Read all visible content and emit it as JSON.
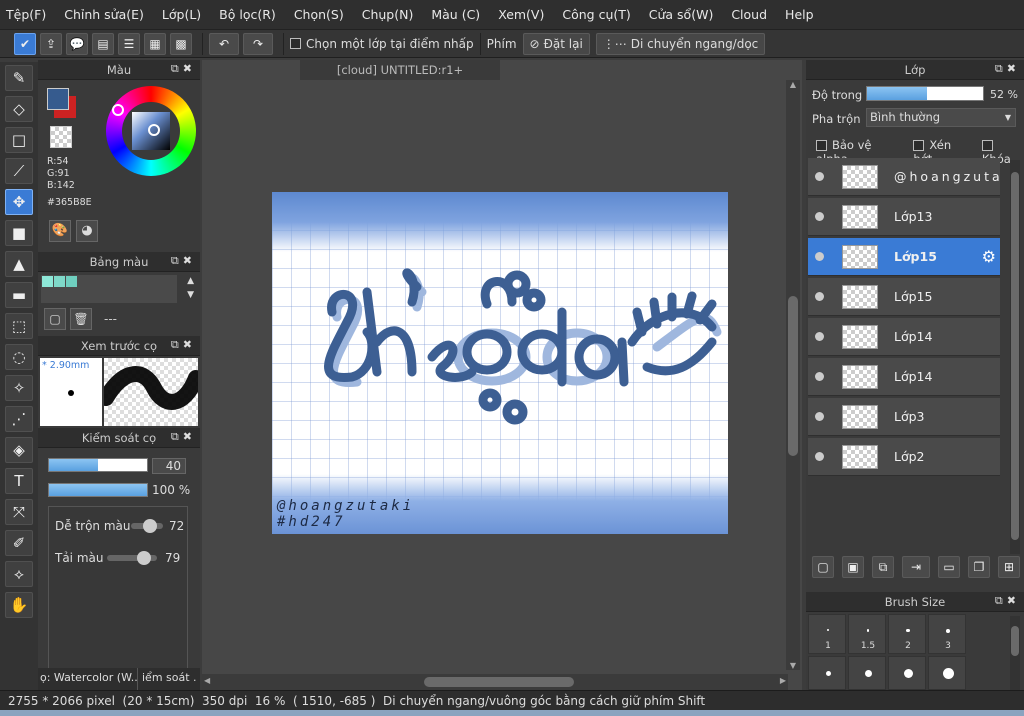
{
  "menu": [
    "Tệp(F)",
    "Chỉnh sửa(E)",
    "Lớp(L)",
    "Bộ lọc(R)",
    "Chọn(S)",
    "Chụp(N)",
    "Màu (C)",
    "Xem(V)",
    "Công cụ(T)",
    "Cửa sổ(W)",
    "Cloud",
    "Help"
  ],
  "toolbar": {
    "select_layer_label": "Chọn một lớp tại điểm nhấp",
    "key_label": "Phím",
    "reset_label": "Đặt lại",
    "pan_label": "Di chuyển ngang/dọc"
  },
  "color_panel": {
    "title": "Màu",
    "r": "R:54",
    "g": "G:91",
    "b": "B:142",
    "hex": "#365B8E",
    "fg_color": "#365b8e",
    "bg_color": "#cc2222"
  },
  "palette_panel": {
    "title": "Bảng màu",
    "swatches": [
      "#8ee8d8",
      "#7fd9c9",
      "#6fcfbf"
    ],
    "value": "---"
  },
  "brush_preview": {
    "title": "Xem trước cọ",
    "size": "* 2.90mm"
  },
  "brush_control": {
    "title": "Kiểm soát cọ",
    "size_value": "40",
    "size_fraction": 0.5,
    "opacity_value": "100 %",
    "opacity_fraction": 1.0,
    "blend_label": "Dễ trộn màu",
    "blend_value": "72",
    "reload_label": "Tải màu",
    "reload_value": "79",
    "tab_left": "ọ: Watercolor (W...",
    "tab_right": "iểm soát ."
  },
  "document": {
    "tab_title": "[cloud] UNTITLED:r1+",
    "signature_1": "@hoangzutaki",
    "signature_2": "#hd247",
    "artwork_text": "theo dõi"
  },
  "layers_panel": {
    "title": "Lớp",
    "opacity_label": "Độ trong",
    "opacity_value": "52 %",
    "opacity_fraction": 0.52,
    "blend_label": "Pha trộn",
    "blend_mode": "Bình thường",
    "opt_alpha": "Bảo vệ alpha",
    "opt_clip": "Xén bớt",
    "opt_lock": "Khóa",
    "layers": [
      {
        "name": "@hoangzuta",
        "selected": false
      },
      {
        "name": "Lớp13",
        "selected": false
      },
      {
        "name": "Lớp15",
        "selected": true
      },
      {
        "name": "Lớp15",
        "selected": false
      },
      {
        "name": "Lớp14",
        "selected": false
      },
      {
        "name": "Lớp14",
        "selected": false
      },
      {
        "name": "Lớp3",
        "selected": false
      },
      {
        "name": "Lớp2",
        "selected": false
      }
    ]
  },
  "brush_size_panel": {
    "title": "Brush Size",
    "sizes": [
      "1",
      "1.5",
      "2",
      "3"
    ]
  },
  "status": {
    "text": "2755 * 2066 pixel  (20 * 15cm)  350 dpi  16 %  ( 1510, -685 )  Di chuyển ngang/vuông góc bằng cách giữ phím Shift"
  }
}
